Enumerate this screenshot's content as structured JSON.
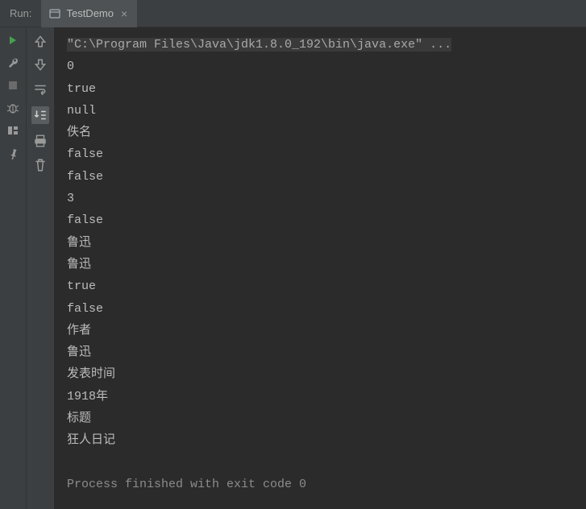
{
  "header": {
    "runLabel": "Run:",
    "tab": {
      "label": "TestDemo"
    }
  },
  "console": {
    "command": "\"C:\\Program Files\\Java\\jdk1.8.0_192\\bin\\java.exe\" ...",
    "output": [
      "0",
      "true",
      "null",
      "佚名",
      "false",
      "false",
      "3",
      "false",
      "鲁迅",
      "鲁迅",
      "true",
      "false",
      "作者",
      "鲁迅",
      "发表时间",
      "1918年",
      "标题",
      "狂人日记"
    ],
    "processLine": "Process finished with exit code 0"
  }
}
